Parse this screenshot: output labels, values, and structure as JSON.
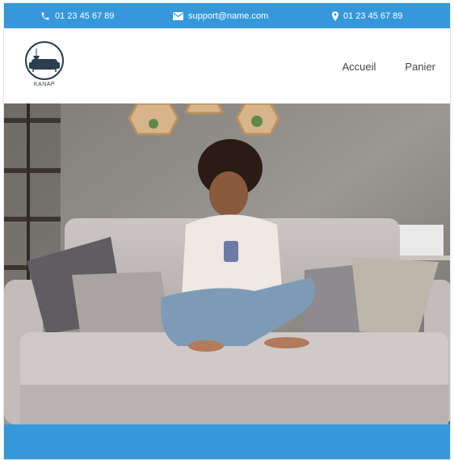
{
  "topbar": {
    "phone_left": "01 23 45 67 89",
    "email": "support@name.com",
    "phone_right": "01 23 45 67 89",
    "phone_icon": "phone-icon",
    "email_icon": "envelope-icon",
    "location_icon": "map-pin-icon"
  },
  "header": {
    "logo_text": "KANAP",
    "nav": [
      "Accueil",
      "Panier"
    ]
  },
  "hero": {
    "description_icon": "hero-photo"
  },
  "colors": {
    "primary": "#3498db",
    "nav_text": "#444444"
  }
}
